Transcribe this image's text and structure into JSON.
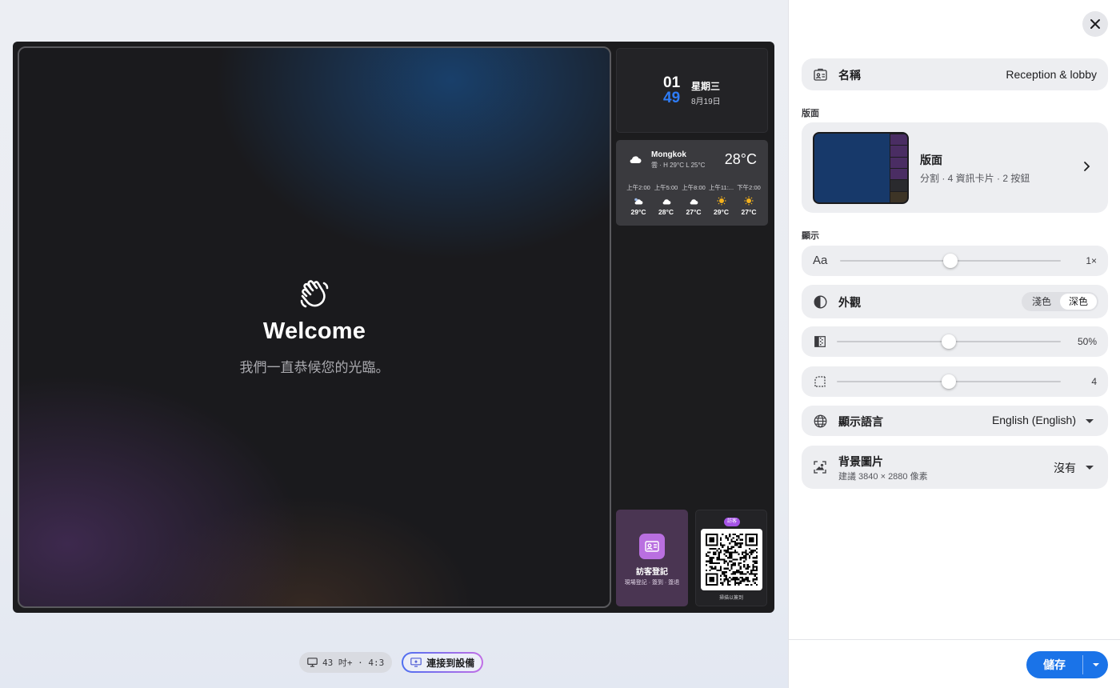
{
  "preview": {
    "welcome_title": "Welcome",
    "welcome_subtitle": "我們一直恭候您的光臨。",
    "clock": {
      "hour": "01",
      "minute": "49",
      "weekday": "星期三",
      "date": "8月19日"
    },
    "weather": {
      "city": "Mongkok",
      "summary": "雲 · H 29°C L 25°C",
      "temp": "28°C",
      "hours": [
        {
          "time": "上午2:00",
          "icon": "cloud-moon-icon",
          "temp": "29°C"
        },
        {
          "time": "上午5:00",
          "icon": "cloud-icon",
          "temp": "28°C"
        },
        {
          "time": "上午8:00",
          "icon": "cloud-icon",
          "temp": "27°C"
        },
        {
          "time": "上午11:...",
          "icon": "sun-icon",
          "temp": "29°C"
        },
        {
          "time": "下午2:00",
          "icon": "sun-icon",
          "temp": "27°C"
        }
      ]
    },
    "visitor": {
      "title": "訪客登記",
      "subtitle": "現場登記 · 簽到 · 簽退"
    },
    "qr": {
      "badge": "訪客",
      "caption": "掃描以簽到"
    },
    "device_info": "43 吋+ · 4:3",
    "connect_label": "連接到設備"
  },
  "panel": {
    "name_label": "名稱",
    "name_value": "Reception & lobby",
    "layout_section": "版面",
    "layout_title": "版面",
    "layout_sub": "分割 · 4 資訊卡片 · 2 按鈕",
    "display_section": "顯示",
    "font_scale_icon": "Aa",
    "font_scale_value": "1×",
    "font_scale_level": 0.5,
    "appearance_label": "外觀",
    "appearance_options": [
      "淺色",
      "深色"
    ],
    "appearance_selected": "深色",
    "opacity_value": "50%",
    "opacity_level": 0.5,
    "radius_value": "4",
    "radius_level": 0.5,
    "language_label": "顯示語言",
    "language_value": "English (English)",
    "bg_label": "背景圖片",
    "bg_hint": "建議 3840 × 2880 像素",
    "bg_value": "沒有",
    "save_label": "儲存"
  },
  "colors": {
    "accent": "#1a73e8",
    "clock_minute": "#2e7cf6",
    "visitor_icon_bg": "#b96fe0"
  }
}
